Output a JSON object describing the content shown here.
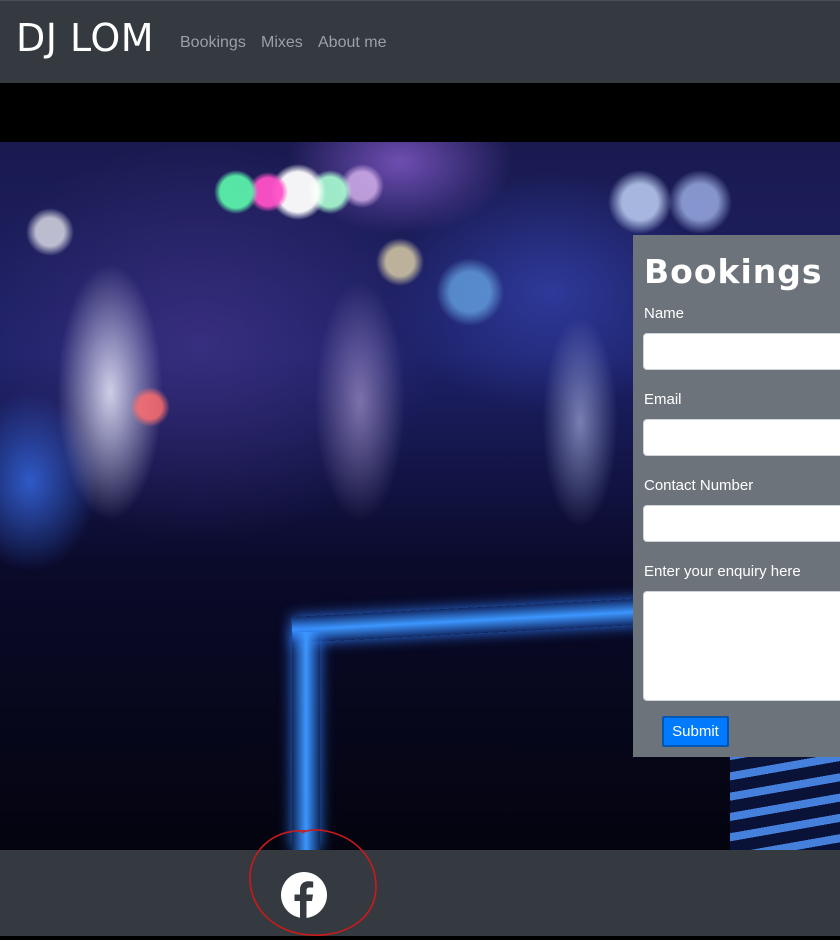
{
  "navbar": {
    "brand": "DJ LOM",
    "links": [
      "Bookings",
      "Mixes",
      "About me"
    ]
  },
  "booking_form": {
    "title": "Bookings",
    "fields": [
      {
        "label": "Name",
        "value": "",
        "placeholder": ""
      },
      {
        "label": "Email",
        "value": "",
        "placeholder": ""
      },
      {
        "label": "Contact Number",
        "value": "",
        "placeholder": ""
      }
    ],
    "enquiry": {
      "label": "Enter your enquiry here",
      "value": "",
      "placeholder": ""
    },
    "submit_label": "Submit"
  },
  "footer": {
    "social_icons": [
      "facebook-icon"
    ]
  },
  "colors": {
    "navbar_bg": "#343a40",
    "form_panel_bg": "#6c737a",
    "submit_bg": "#007bff",
    "annotation_red": "#cc1a1a"
  }
}
